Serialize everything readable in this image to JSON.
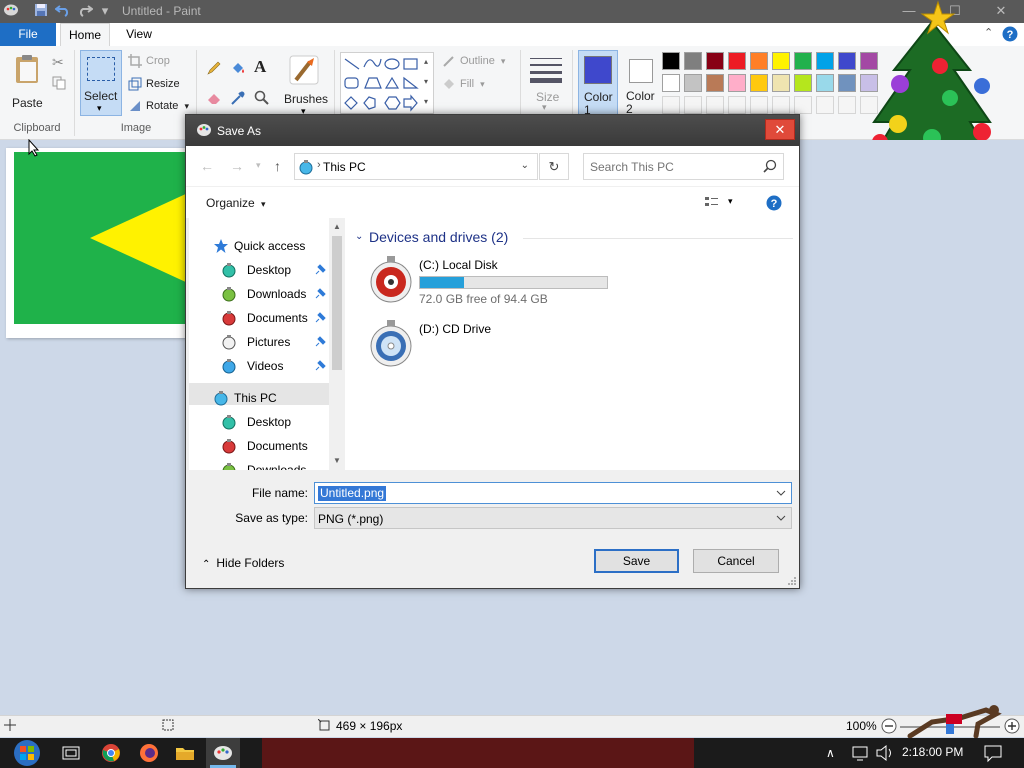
{
  "window": {
    "title": "Untitled - Paint"
  },
  "ribbon_tabs": [
    "File",
    "Home",
    "View"
  ],
  "clipboard": {
    "paste_label": "Paste",
    "group_label": "Clipboard"
  },
  "image_group": {
    "select_label": "Select",
    "crop_label": "Crop",
    "resize_label": "Resize",
    "rotate_label": "Rotate",
    "group_label": "Image"
  },
  "tools": {
    "brushes_label": "Brushes"
  },
  "shapes": {
    "outline_label": "Outline",
    "fill_label": "Fill"
  },
  "size": {
    "label": "Size"
  },
  "colors": {
    "color1_label": "Color 1",
    "color2_label": "Color 2",
    "color1_value": "#3f48cc",
    "color2_value": "#ffffff",
    "palette_row1": [
      "#000000",
      "#7f7f7f",
      "#880015",
      "#ed1c24",
      "#ff7f27",
      "#fff200",
      "#22b14c",
      "#00a2e8",
      "#3f48cc",
      "#a349a4"
    ],
    "palette_row2": [
      "#ffffff",
      "#c3c3c3",
      "#b97a57",
      "#ffaec9",
      "#ffc90e",
      "#efe4b0",
      "#b5e61d",
      "#99d9ea",
      "#7092be",
      "#c8bfe7"
    ],
    "palette_row3": [
      "#f5f5f5",
      "#f5f5f5",
      "#f5f5f5",
      "#f5f5f5",
      "#f5f5f5",
      "#f5f5f5",
      "#f5f5f5",
      "#f5f5f5",
      "#f5f5f5",
      "#f5f5f5"
    ]
  },
  "canvas": {
    "background": "#1fb24a",
    "shape_color": "#fff200"
  },
  "status": {
    "selection_size": "469 × 196px",
    "zoom": "100%"
  },
  "taskbar": {
    "time": "2:18:00 PM"
  },
  "dialog": {
    "title": "Save As",
    "address": "This PC",
    "search_placeholder": "Search This PC",
    "organize_label": "Organize",
    "nav": {
      "quick_access": "Quick access",
      "items": [
        "Desktop",
        "Downloads",
        "Documents",
        "Pictures",
        "Videos"
      ],
      "this_pc": "This PC",
      "this_pc_items": [
        "Desktop",
        "Documents",
        "Downloads"
      ]
    },
    "group_header": "Devices and drives (2)",
    "drives": [
      {
        "name": "(C:) Local Disk",
        "free_text": "72.0 GB free of 94.4 GB",
        "used_fraction": 0.237
      },
      {
        "name": "(D:) CD Drive"
      }
    ],
    "file_name_label": "File name:",
    "file_name_value": "Untitled.png",
    "save_type_label": "Save as type:",
    "save_type_value": "PNG (*.png)",
    "save_button": "Save",
    "cancel_button": "Cancel",
    "hide_folders_label": "Hide Folders"
  }
}
